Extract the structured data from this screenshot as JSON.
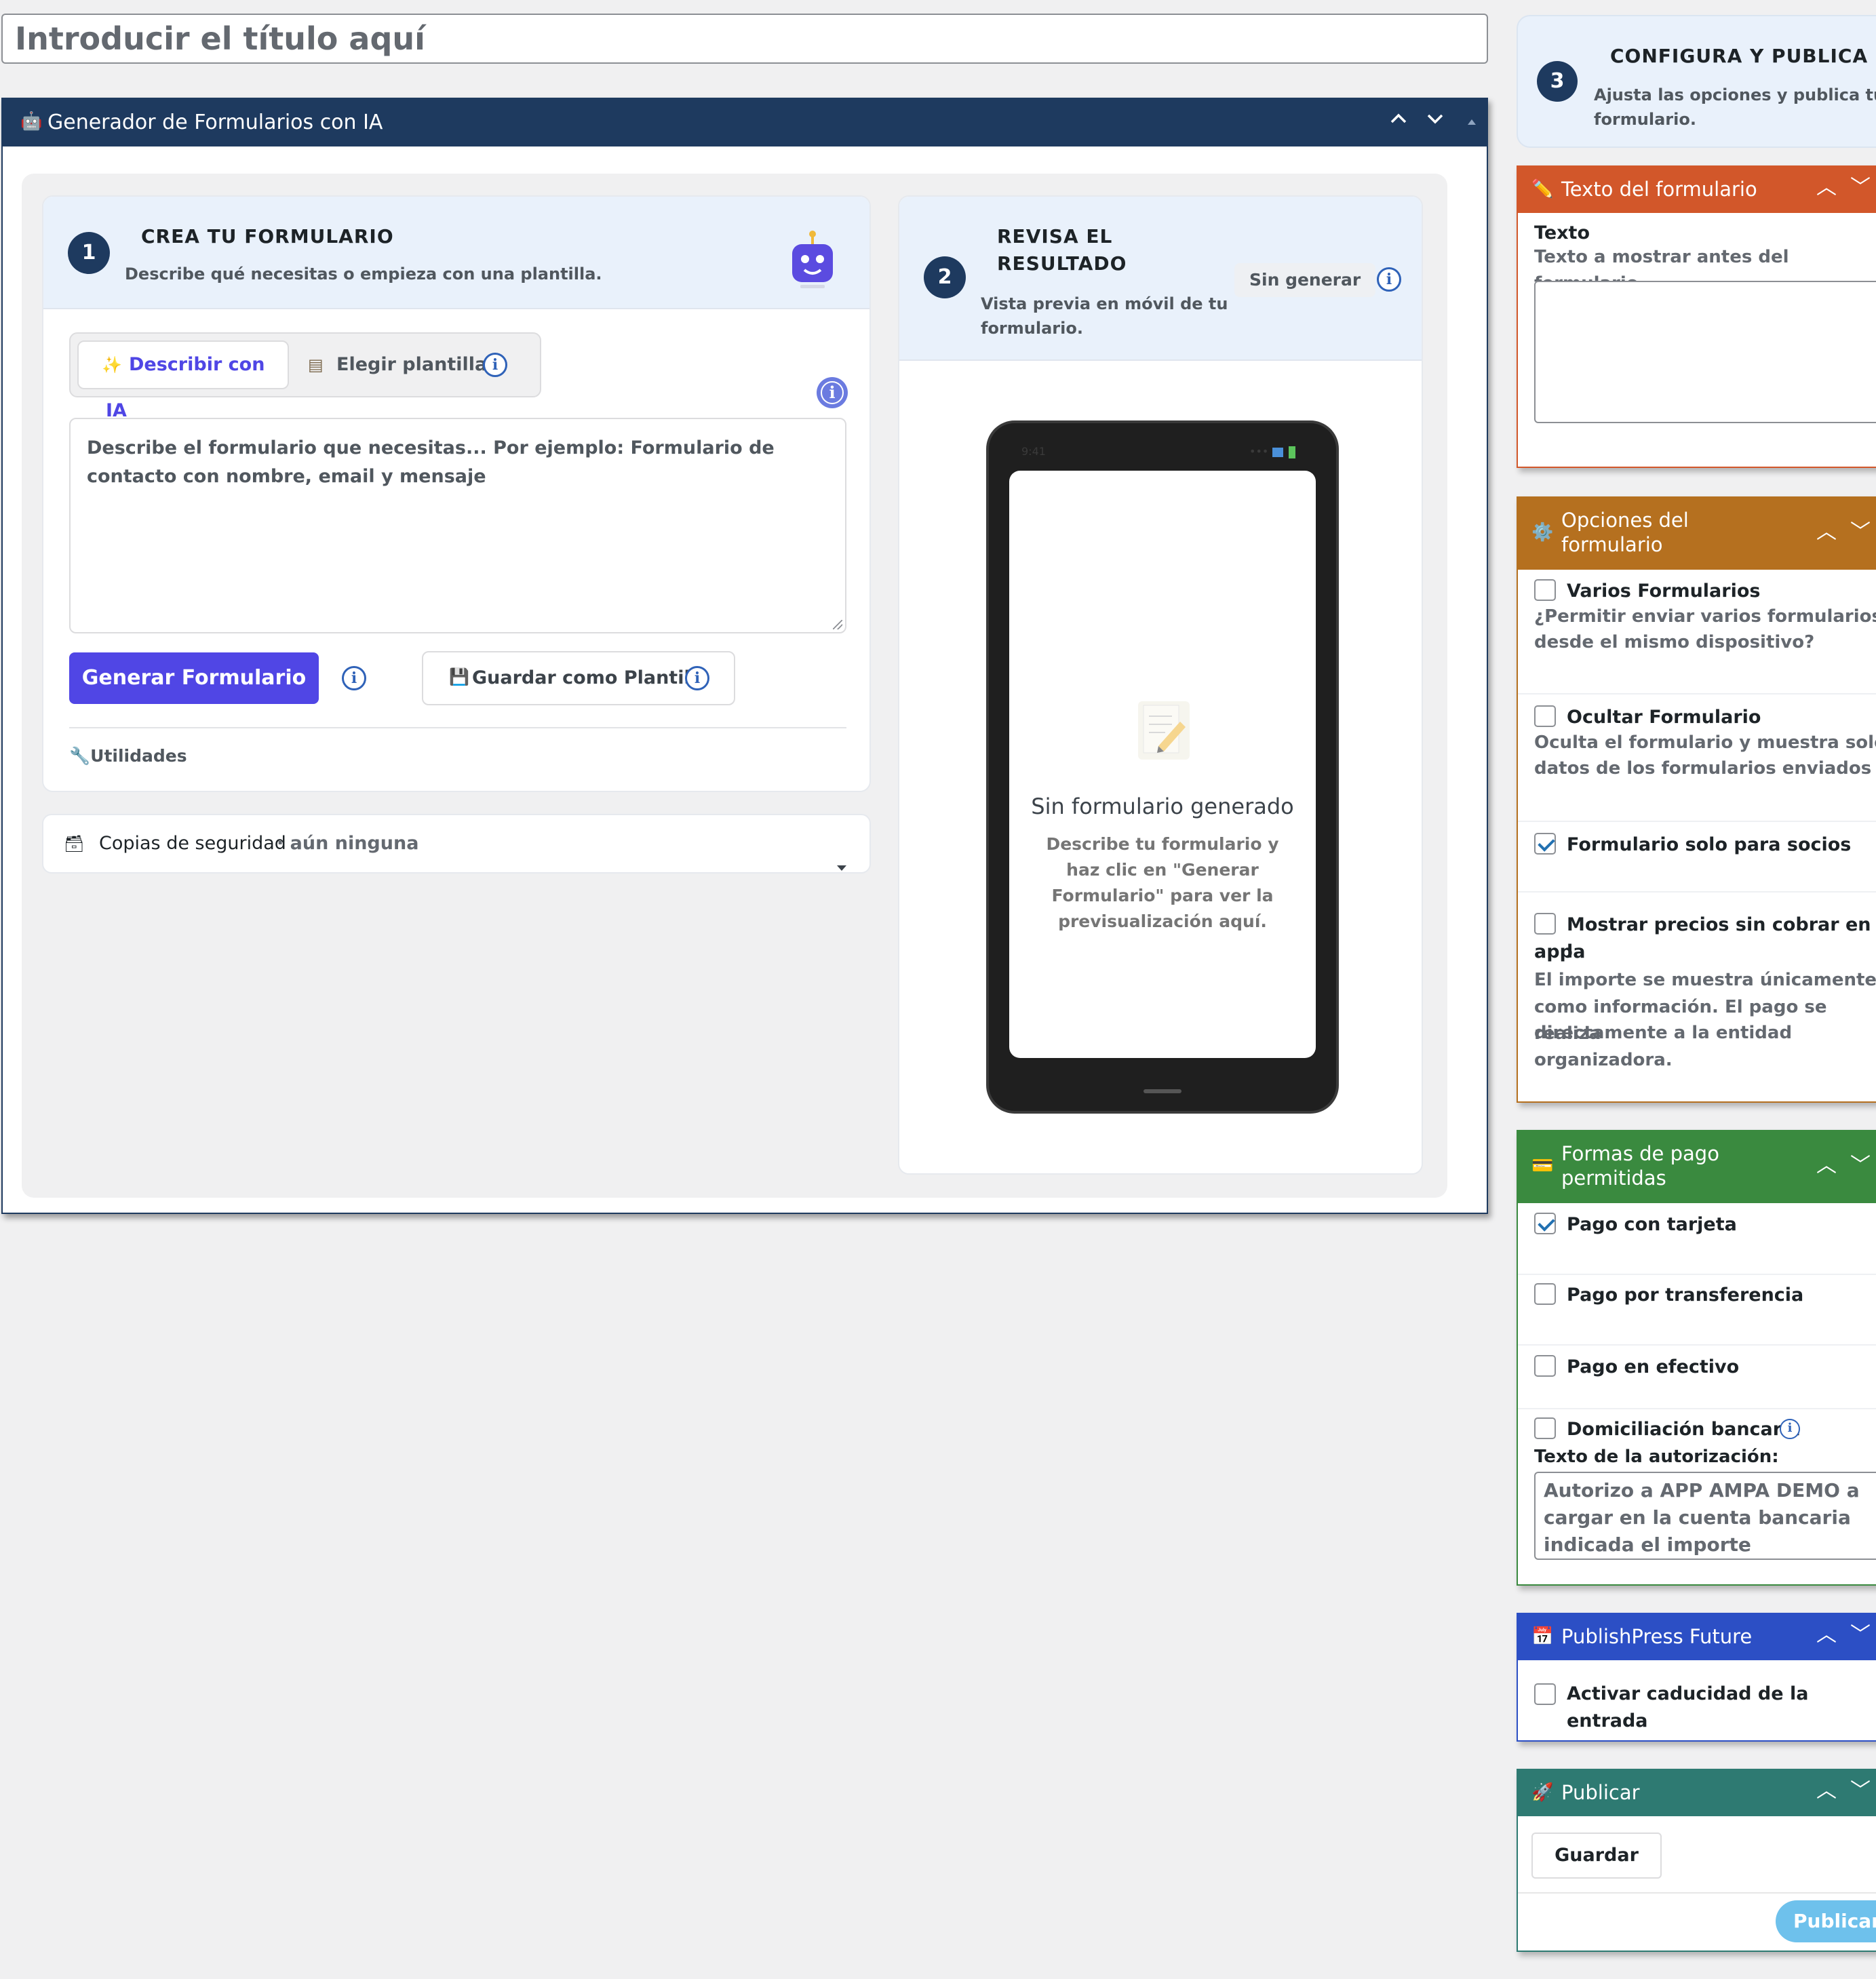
{
  "title_input": {
    "placeholder": "Introducir el título aquí"
  },
  "main_box": {
    "title": "Generador de Formularios con IA",
    "robot_icon": "robot-icon",
    "collapse_controls": [
      "^",
      "v",
      "▲"
    ]
  },
  "step1": {
    "number": "1",
    "title": "CREA TU FORMULARIO",
    "subtitle": "Describe qué necesitas o empieza con una plantilla.",
    "tabs": [
      {
        "label": "Describir con IA",
        "icon": "sparkle-icon",
        "active": true
      },
      {
        "label": "Elegir plantilla",
        "icon": "template-icon",
        "active": false
      }
    ],
    "textarea_placeholder": "Describe el formulario que necesitas... Por ejemplo: Formulario de contacto con nombre, email y mensaje",
    "generate_button": "Generar Formulario",
    "save_template_button": "Guardar como Plantilla",
    "utilities_label": "Utilidades",
    "backup_label": "Copias de seguridad",
    "backup_status": "· aún ninguna"
  },
  "step2": {
    "number": "2",
    "title_line1": "REVISA EL",
    "title_line2": "RESULTADO",
    "subtitle_line1": "Vista previa en móvil de tu",
    "subtitle_line2": "formulario.",
    "badge": "Sin generar",
    "phone_time": "9:41",
    "empty_title": "Sin formulario generado",
    "empty_desc": "Describe tu formulario y haz clic en \"Generar Formulario\" para ver la previsualización aquí."
  },
  "step3": {
    "number": "3",
    "title": "CONFIGURA Y PUBLICA",
    "subtitle_line1": "Ajusta las opciones y publica tu",
    "subtitle_line2": "formulario."
  },
  "texto_box": {
    "title": "Texto del formulario",
    "color": "#d2572a",
    "field_label": "Texto",
    "field_hint": "Texto a mostrar antes del formulario"
  },
  "opciones_box": {
    "title_line1": "Opciones del",
    "title_line2": "formulario",
    "color": "#b5701f",
    "options": [
      {
        "label": "Varios Formularios",
        "hint_line1": "¿Permitir enviar varios formularios",
        "hint_line2": "desde el mismo dispositivo?",
        "checked": false
      },
      {
        "label": "Ocultar Formulario",
        "hint_line1": "Oculta el formulario y muestra solo los",
        "hint_line2": "datos de los formularios enviados",
        "checked": false
      },
      {
        "label": "Formulario solo para socios",
        "checked": true
      },
      {
        "label_line1": "Mostrar precios sin cobrar en la",
        "label_line2": "app",
        "hint_line1": "El importe se muestra únicamente",
        "hint_line2": "como información. El pago se realiza",
        "hint_line3": "directamente a la entidad",
        "hint_line4": "organizadora.",
        "checked": false
      }
    ]
  },
  "pago_box": {
    "title_line1": "Formas de pago",
    "title_line2": "permitidas",
    "color": "#3a8a3f",
    "options": [
      {
        "label": "Pago con tarjeta",
        "checked": true
      },
      {
        "label": "Pago por transferencia",
        "checked": false
      },
      {
        "label": "Pago en efectivo",
        "checked": false
      },
      {
        "label": "Domiciliación bancaria",
        "checked": false
      }
    ],
    "auth_label": "Texto de la autorización:",
    "auth_text_line1": "Autorizo a APP AMPA DEMO a",
    "auth_text_line2": "cargar en la cuenta bancaria",
    "auth_text_line3": "indicada el importe"
  },
  "future_box": {
    "title": "PublishPress Future",
    "color": "#2c4fc5",
    "option": "Activar caducidad de la entrada"
  },
  "publicar_box": {
    "title": "Publicar",
    "color": "#2e7a72",
    "save_button": "Guardar",
    "publish_button": "Publicar"
  }
}
